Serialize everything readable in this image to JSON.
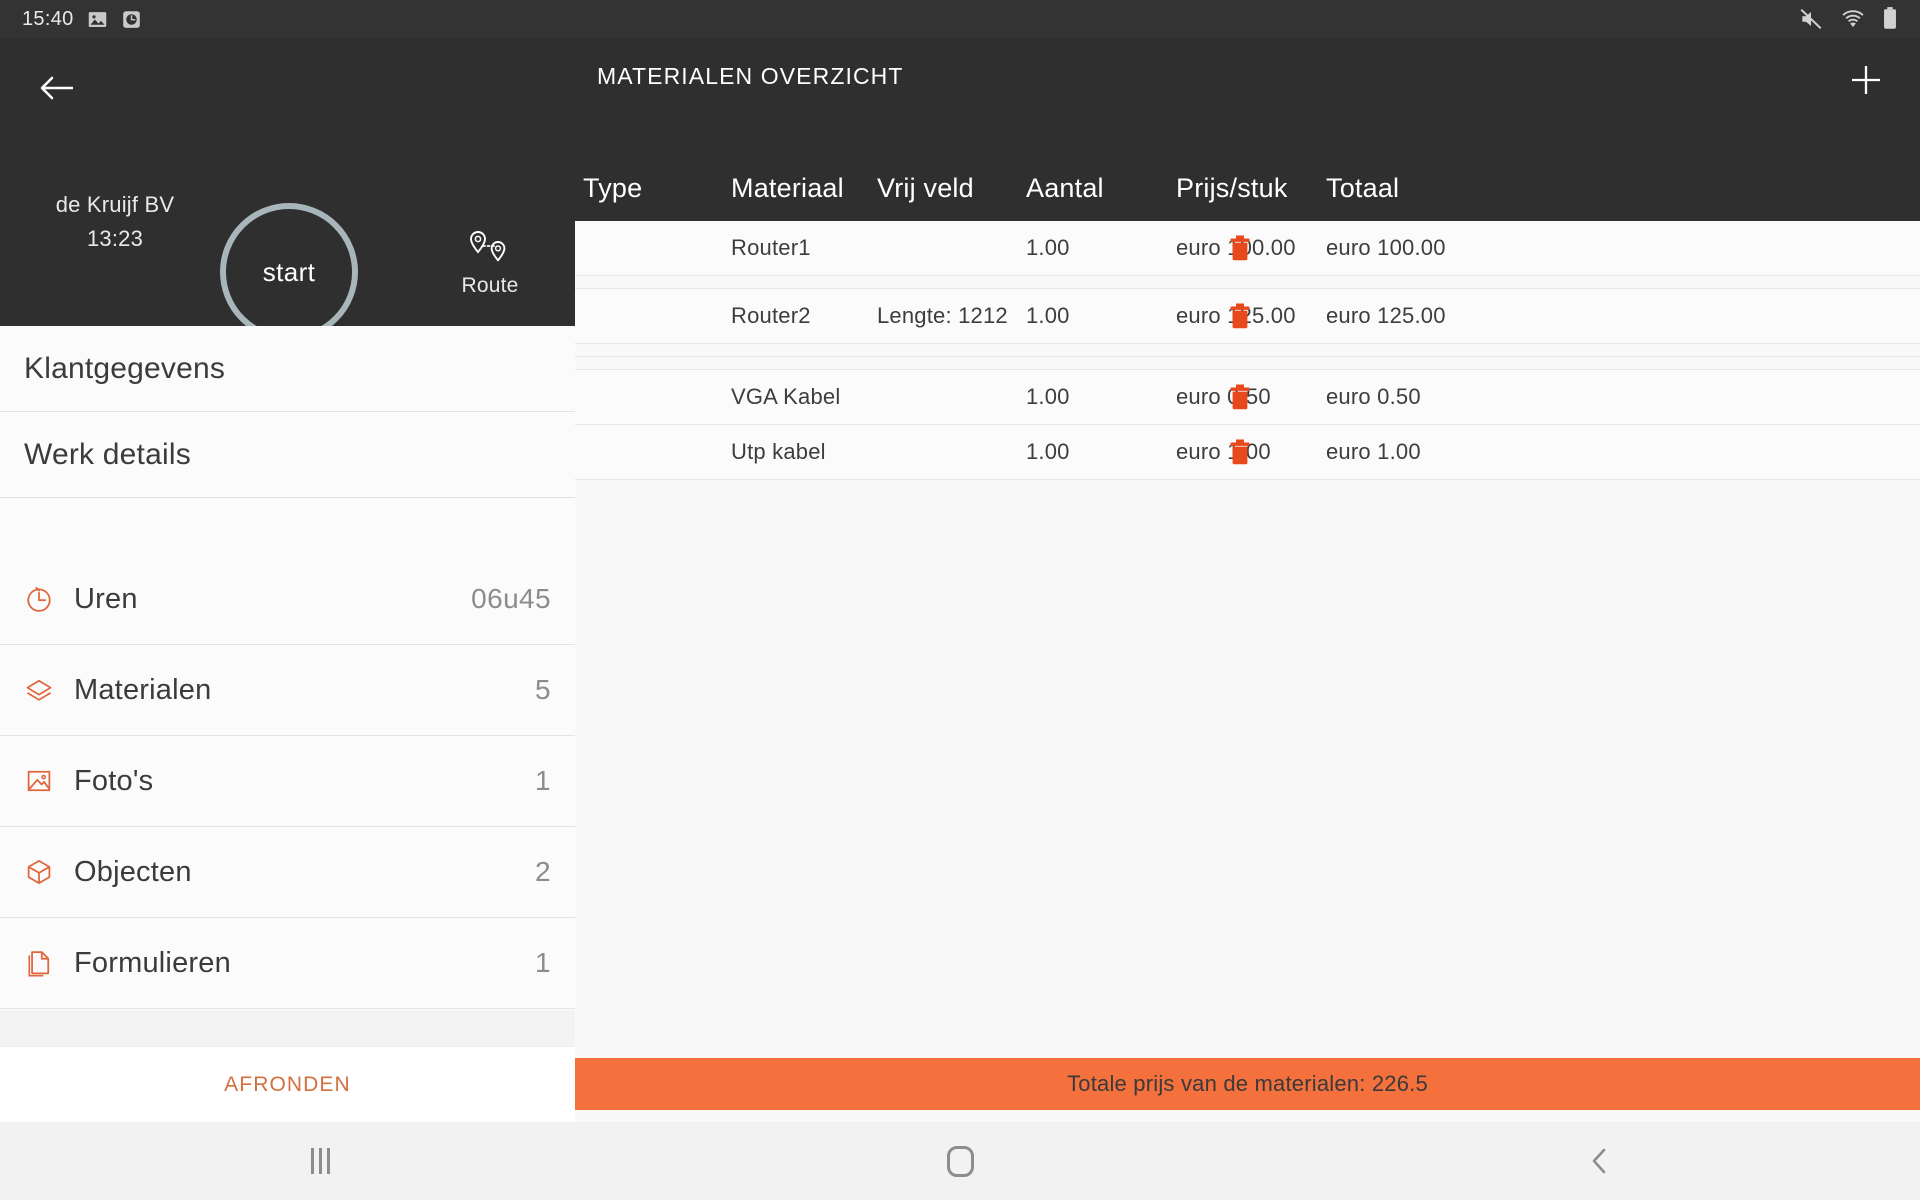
{
  "statusbar": {
    "time": "15:40",
    "left_icons": [
      "image-icon",
      "screen-record-icon"
    ],
    "right_icons": [
      "mute-icon",
      "wifi-icon",
      "battery-icon"
    ]
  },
  "job_panel": {
    "back_icon": "arrow-left-icon",
    "customer": "de Kruijf BV",
    "time": "13:23",
    "start_label": "start",
    "route_label": "Route",
    "route_icon": "route-pins-icon"
  },
  "left_list": {
    "simple_items": [
      {
        "label": "Klantgegevens"
      },
      {
        "label": "Werk details"
      }
    ],
    "count_items": [
      {
        "icon": "clock-icon",
        "label": "Uren",
        "value": "06u45"
      },
      {
        "icon": "layers-icon",
        "label": "Materialen",
        "value": "5"
      },
      {
        "icon": "photo-icon",
        "label": "Foto's",
        "value": "1"
      },
      {
        "icon": "cube-icon",
        "label": "Objecten",
        "value": "2"
      },
      {
        "icon": "file-icon",
        "label": "Formulieren",
        "value": "1"
      }
    ],
    "finish_label": "AFRONDEN"
  },
  "materials": {
    "title": "MATERIALEN OVERZICHT",
    "add_icon": "plus-icon",
    "delete_icon": "trash-icon",
    "columns": [
      "Type",
      "Materiaal",
      "Vrij veld",
      "Aantal",
      "Prijs/stuk",
      "Totaal"
    ],
    "rows": [
      {
        "type": "",
        "materiaal": "Router1",
        "vrij_veld": "",
        "aantal": "1.00",
        "prijs": "euro 100.00",
        "totaal": "euro 100.00"
      },
      {
        "type": "",
        "materiaal": "Router2",
        "vrij_veld": "Lengte: 1212",
        "aantal": "1.00",
        "prijs": "euro 125.00",
        "totaal": "euro 125.00"
      },
      {
        "type": "",
        "materiaal": "VGA Kabel",
        "vrij_veld": "",
        "aantal": "1.00",
        "prijs": "euro 0.50",
        "totaal": "euro 0.50"
      },
      {
        "type": "",
        "materiaal": "Utp kabel",
        "vrij_veld": "",
        "aantal": "1.00",
        "prijs": "euro 1.00",
        "totaal": "euro 1.00"
      }
    ],
    "total_text": "Totale prijs van de materialen: 226.5"
  },
  "navbar": {
    "recents_icon": "recents-icon",
    "home_icon": "home-icon",
    "back_icon": "back-chevron-icon"
  },
  "colors": {
    "accent_orange": "#f4703c",
    "icon_orange": "#e0643a",
    "trash_red": "#e8491c",
    "dark_panel": "#2f2f2f",
    "statusbar": "#333333"
  }
}
